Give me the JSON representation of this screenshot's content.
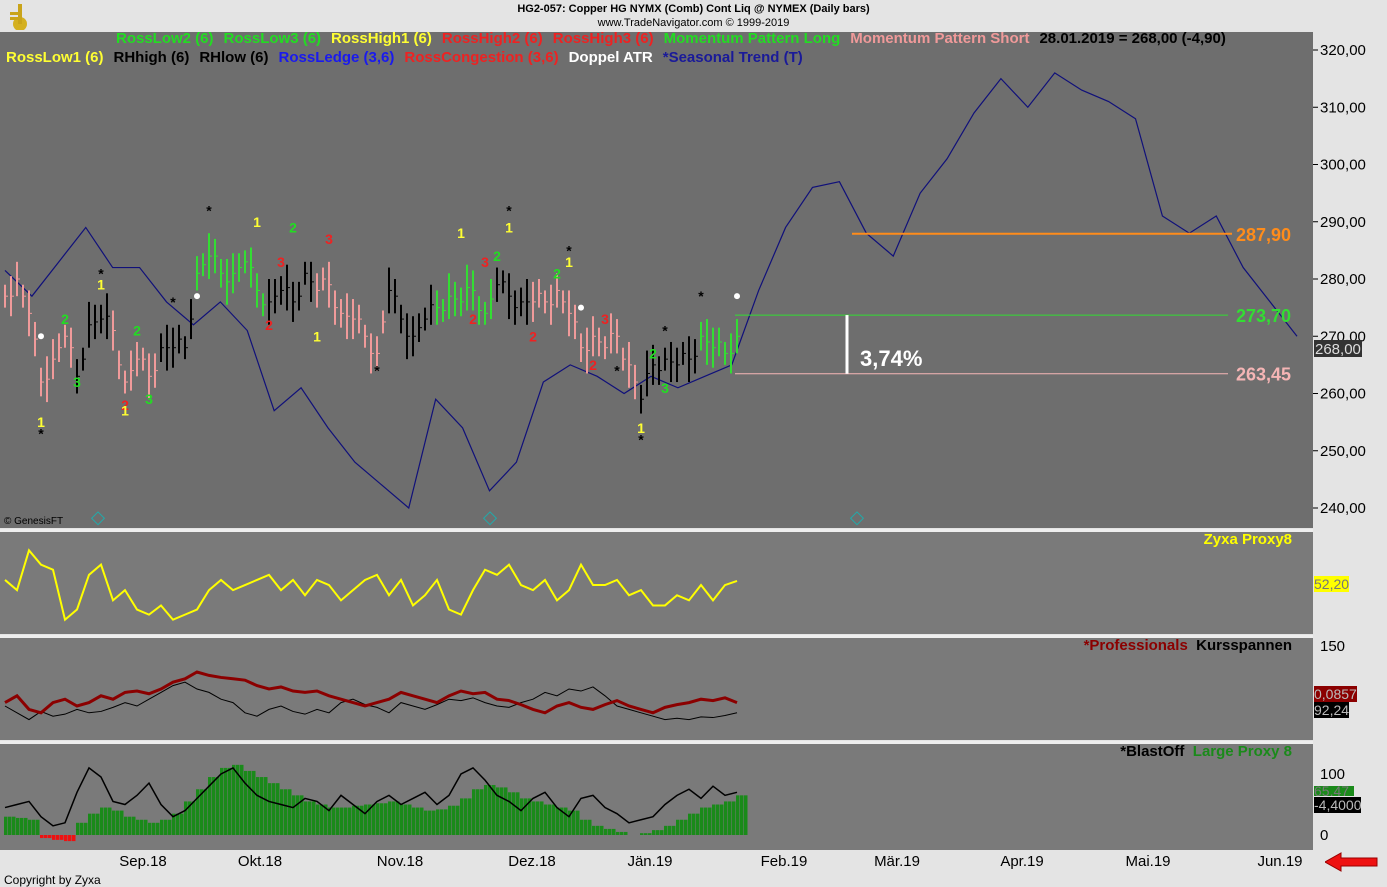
{
  "header": {
    "title": "HG2-057:  Copper HG NYMX (Comb) Cont Liq @ NYMEX  (Daily bars)",
    "copyright": "www.TradeNavigator.com © 1999-2019"
  },
  "legend_row1": [
    {
      "text": "RossLow2 (6)",
      "color": "#22dd22"
    },
    {
      "text": "RossLow3 (6)",
      "color": "#22dd22"
    },
    {
      "text": "RossHigh1 (6)",
      "color": "#ffff33"
    },
    {
      "text": "RossHigh2 (6)",
      "color": "#ee2222"
    },
    {
      "text": "RossHigh3 (6)",
      "color": "#ee2222"
    },
    {
      "text": "Momentum Pattern Long",
      "color": "#22dd22"
    },
    {
      "text": "Momentum Pattern Short",
      "color": "#f09a9a"
    },
    {
      "text": "28.01.2019 = 268,00 (-4,90)",
      "color": "#000000"
    }
  ],
  "legend_row2": [
    {
      "text": "RossLow1 (6)",
      "color": "#ffff33"
    },
    {
      "text": "RHhigh (6)",
      "color": "#000000"
    },
    {
      "text": "RHlow (6)",
      "color": "#000000"
    },
    {
      "text": "RossLedge (3,6)",
      "color": "#1a1aee"
    },
    {
      "text": "RossCongestion (3,6)",
      "color": "#ee2222"
    },
    {
      "text": "Doppel ATR",
      "color": "#ffffff"
    },
    {
      "text": "*Seasonal Trend (T)",
      "color": "#1a1a99"
    }
  ],
  "watermark": "© GenesisFT",
  "footer": "Copyright by Zyxa",
  "price_axis": [
    "320,00",
    "310,00",
    "300,00",
    "290,00",
    "280,00",
    "270,00",
    "260,00",
    "250,00",
    "240,00"
  ],
  "last_price_tag": "268,00",
  "levels": [
    {
      "value": 287.9,
      "label": "287,90",
      "color": "#ff8c1a"
    },
    {
      "value": 273.7,
      "label": "273,70",
      "color": "#33dd33"
    },
    {
      "value": 263.45,
      "label": "263,45",
      "color": "#f5b5b5"
    }
  ],
  "range_label": "3,74%",
  "panels": {
    "zyxa": {
      "title": "Zyxa Proxy8",
      "tag": "52,20",
      "color": "#ffff00"
    },
    "pro": {
      "title1": "*Professionals",
      "title2": "Kursspannen",
      "axis": "150",
      "tag1": "0,0857",
      "tag2": "92,24"
    },
    "blast": {
      "title1": "*BlastOff",
      "title2": "Large Proxy 8",
      "axis_top": "100",
      "axis_bottom": "0",
      "tag1": "65,47",
      "tag2": "-4,4000"
    }
  },
  "x_axis": [
    "Sep.18",
    "Okt.18",
    "Nov.18",
    "Dez.18",
    "Jän.19",
    "Feb.19",
    "Mär.19",
    "Apr.19",
    "Mai.19",
    "Jun.19"
  ],
  "chart_data": {
    "type": "line",
    "title": "HG2-057 Copper HG NYMX Daily bars",
    "ylim": [
      240,
      320
    ],
    "price_closes": [
      277,
      280,
      274,
      262,
      266,
      270,
      263,
      272,
      273,
      271,
      262,
      266,
      263,
      268,
      268,
      268,
      281,
      284,
      281,
      281,
      283,
      278,
      276,
      278,
      276,
      281,
      278,
      279,
      274,
      273,
      270,
      267,
      278,
      273,
      270,
      273,
      275,
      277,
      276,
      278,
      274,
      279,
      277,
      276,
      276,
      276,
      278,
      274,
      268,
      270,
      268,
      270,
      265,
      259,
      265,
      266,
      265,
      266,
      270,
      268,
      267,
      270
    ],
    "bar_colors": "rrrrrrkkkrrrrkkkggggggkkkkrrrrrrkkkkgggggkkkrrrrrrrrrkkkkkgggg",
    "seasonal_trend": [
      281.5,
      277,
      283,
      289,
      282,
      282,
      276,
      272,
      276,
      271,
      257,
      261,
      254,
      248,
      244,
      240,
      259,
      254,
      243,
      248,
      262,
      265,
      263,
      260,
      263,
      261,
      263,
      265,
      278,
      289,
      296,
      297,
      288,
      284,
      295,
      301,
      309,
      315,
      310,
      316,
      313,
      311,
      308,
      291,
      288,
      291,
      282,
      276,
      270
    ],
    "markers": [
      {
        "i": 3,
        "p": 255,
        "t": "1",
        "c": "#ffff33"
      },
      {
        "i": 3,
        "p": 253,
        "t": "*",
        "c": "#000"
      },
      {
        "i": 5,
        "p": 273,
        "t": "2",
        "c": "#22dd22"
      },
      {
        "i": 6,
        "p": 262,
        "t": "3",
        "c": "#22dd22"
      },
      {
        "i": 8,
        "p": 279,
        "t": "1",
        "c": "#ffff33"
      },
      {
        "i": 8,
        "p": 281,
        "t": "*",
        "c": "#000"
      },
      {
        "i": 10,
        "p": 258,
        "t": "2",
        "c": "#ee2222"
      },
      {
        "i": 10,
        "p": 257,
        "t": "1",
        "c": "#ffff33"
      },
      {
        "i": 11,
        "p": 271,
        "t": "2",
        "c": "#22dd22"
      },
      {
        "i": 12,
        "p": 259,
        "t": "3",
        "c": "#22dd22"
      },
      {
        "i": 14,
        "p": 276,
        "t": "*",
        "c": "#000"
      },
      {
        "i": 17,
        "p": 292,
        "t": "*",
        "c": "#000"
      },
      {
        "i": 21,
        "p": 290,
        "t": "1",
        "c": "#ffff33"
      },
      {
        "i": 22,
        "p": 272,
        "t": "2",
        "c": "#ee2222"
      },
      {
        "i": 23,
        "p": 283,
        "t": "3",
        "c": "#ee2222"
      },
      {
        "i": 24,
        "p": 289,
        "t": "2",
        "c": "#22dd22"
      },
      {
        "i": 27,
        "p": 287,
        "t": "3",
        "c": "#ee2222"
      },
      {
        "i": 26,
        "p": 270,
        "t": "1",
        "c": "#ffff33"
      },
      {
        "i": 31,
        "p": 264,
        "t": "*",
        "c": "#000"
      },
      {
        "i": 38,
        "p": 288,
        "t": "1",
        "c": "#ffff33"
      },
      {
        "i": 39,
        "p": 273,
        "t": "2",
        "c": "#ee2222"
      },
      {
        "i": 40,
        "p": 283,
        "t": "3",
        "c": "#ee2222"
      },
      {
        "i": 41,
        "p": 284,
        "t": "2",
        "c": "#22dd22"
      },
      {
        "i": 42,
        "p": 292,
        "t": "*",
        "c": "#000"
      },
      {
        "i": 42,
        "p": 289,
        "t": "1",
        "c": "#ffff33"
      },
      {
        "i": 44,
        "p": 270,
        "t": "2",
        "c": "#ee2222"
      },
      {
        "i": 46,
        "p": 281,
        "t": "2",
        "c": "#22dd22"
      },
      {
        "i": 47,
        "p": 283,
        "t": "1",
        "c": "#ffff33"
      },
      {
        "i": 47,
        "p": 285,
        "t": "*",
        "c": "#000"
      },
      {
        "i": 50,
        "p": 273,
        "t": "3",
        "c": "#ee2222"
      },
      {
        "i": 49,
        "p": 265,
        "t": "2",
        "c": "#ee2222"
      },
      {
        "i": 51,
        "p": 264,
        "t": "*",
        "c": "#000"
      },
      {
        "i": 53,
        "p": 254,
        "t": "1",
        "c": "#ffff33"
      },
      {
        "i": 53,
        "p": 252,
        "t": "*",
        "c": "#000"
      },
      {
        "i": 54,
        "p": 267,
        "t": "2",
        "c": "#22dd22"
      },
      {
        "i": 55,
        "p": 261,
        "t": "3",
        "c": "#22dd22"
      },
      {
        "i": 55,
        "p": 271,
        "t": "*",
        "c": "#000"
      },
      {
        "i": 58,
        "p": 277,
        "t": "*",
        "c": "#000"
      }
    ],
    "zyxa": [
      53,
      43,
      82,
      68,
      63,
      14,
      24,
      58,
      68,
      33,
      43,
      24,
      19,
      28,
      14,
      19,
      24,
      43,
      53,
      43,
      48,
      53,
      58,
      43,
      53,
      38,
      53,
      48,
      33,
      43,
      53,
      58,
      38,
      53,
      28,
      38,
      53,
      24,
      19,
      43,
      63,
      58,
      68,
      48,
      43,
      53,
      33,
      43,
      68,
      48,
      48,
      53,
      38,
      43,
      28,
      28,
      38,
      33,
      48,
      33,
      48,
      52
    ],
    "professionals": [
      55,
      65,
      45,
      40,
      55,
      60,
      50,
      55,
      65,
      60,
      70,
      72,
      68,
      75,
      85,
      90,
      100,
      95,
      92,
      90,
      88,
      80,
      75,
      78,
      72,
      70,
      72,
      65,
      60,
      55,
      50,
      55,
      60,
      70,
      65,
      60,
      55,
      65,
      72,
      68,
      70,
      60,
      58,
      52,
      45,
      40,
      50,
      55,
      48,
      45,
      52,
      58,
      50,
      45,
      40,
      48,
      52,
      55,
      60,
      58,
      62,
      55
    ],
    "kursspannen": [
      50,
      40,
      30,
      42,
      35,
      38,
      45,
      40,
      42,
      48,
      55,
      50,
      60,
      70,
      80,
      85,
      75,
      70,
      60,
      55,
      40,
      35,
      45,
      50,
      42,
      38,
      45,
      40,
      55,
      60,
      52,
      48,
      40,
      55,
      50,
      45,
      52,
      60,
      58,
      62,
      55,
      50,
      48,
      55,
      60,
      70,
      65,
      75,
      72,
      78,
      65,
      50,
      45,
      40,
      35,
      30,
      32,
      30,
      34,
      33,
      36,
      40
    ],
    "blastoff": [
      35,
      40,
      45,
      20,
      5,
      10,
      60,
      100,
      85,
      45,
      40,
      55,
      75,
      40,
      20,
      30,
      50,
      70,
      90,
      100,
      75,
      55,
      45,
      40,
      35,
      50,
      45,
      30,
      55,
      40,
      25,
      45,
      55,
      40,
      50,
      60,
      40,
      55,
      90,
      100,
      80,
      55,
      45,
      30,
      50,
      60,
      35,
      20,
      50,
      55,
      35,
      25,
      10,
      15,
      20,
      40,
      55,
      65,
      50,
      70,
      55,
      60
    ],
    "proxy8": [
      30,
      28,
      25,
      -5,
      -8,
      -10,
      20,
      35,
      45,
      40,
      30,
      25,
      20,
      25,
      35,
      55,
      75,
      95,
      110,
      115,
      105,
      95,
      85,
      75,
      65,
      55,
      50,
      45,
      45,
      48,
      50,
      52,
      55,
      50,
      45,
      40,
      42,
      48,
      60,
      75,
      82,
      78,
      70,
      60,
      55,
      50,
      45,
      40,
      25,
      15,
      10,
      5,
      0,
      3,
      8,
      15,
      25,
      35,
      45,
      50,
      55,
      65
    ]
  }
}
